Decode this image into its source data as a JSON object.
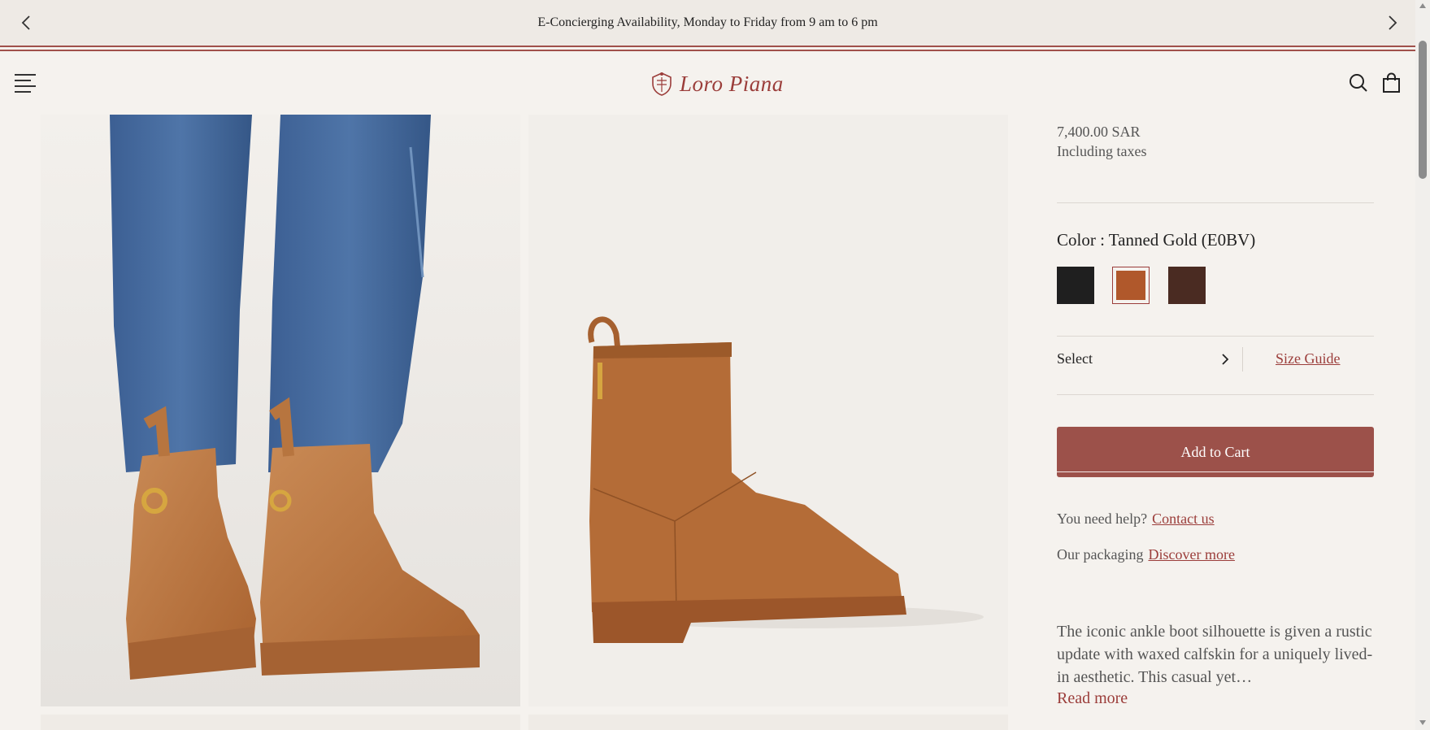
{
  "announcement": {
    "text": "E-Concierging Availability, Monday to Friday from 9 am to 6 pm"
  },
  "header": {
    "brand": "Loro Piana"
  },
  "product": {
    "price": "7,400.00 SAR",
    "tax_note": "Including taxes",
    "color_label": "Color : Tanned Gold (E0BV)",
    "swatches": [
      {
        "name": "black",
        "color": "#1f1f1f",
        "selected": false
      },
      {
        "name": "tanned-gold",
        "color": "#b0582b",
        "selected": true
      },
      {
        "name": "dark-brown",
        "color": "#4a2b22",
        "selected": false
      }
    ],
    "select_label": "Select",
    "size_guide": "Size Guide",
    "add_to_cart": "Add to Cart",
    "help_text": "You need help?",
    "help_link": "Contact us",
    "packaging_text": "Our packaging",
    "packaging_link": "Discover more",
    "description": "The iconic ankle boot silhouette is given a rustic update with waxed calfskin for a uniquely lived-in aesthetic. This casual yet…",
    "read_more": "Read more"
  },
  "colors": {
    "brand": "#9b3d3a",
    "cart_button": "#9c514a",
    "background": "#f5f2ee"
  }
}
